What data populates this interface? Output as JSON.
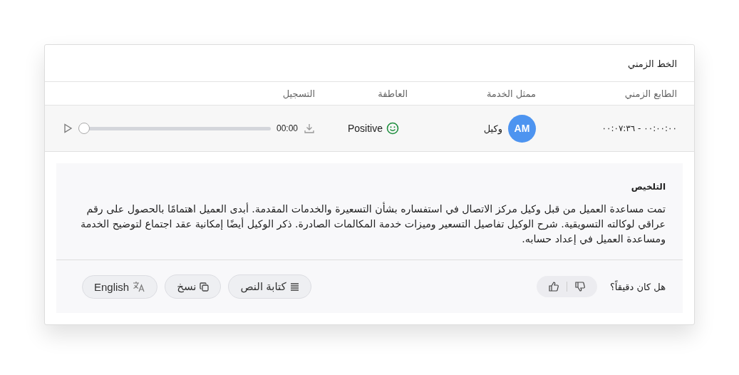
{
  "card": {
    "title": "الخط الزمني"
  },
  "table": {
    "columns": [
      "الطابع الزمني",
      "ممثل الخدمة",
      "العاطفة",
      "التسجيل"
    ],
    "rows": [
      {
        "timestamp": "٠٠:٠٠:٠٠ - ٠٠:٠٧:٣٦",
        "agent_initials": "AM",
        "agent_name": "وكيل",
        "sentiment": "Positive",
        "recording": {
          "time": "00:00",
          "level": 0
        }
      }
    ]
  },
  "summary": {
    "heading": "التلخيص",
    "text": "تمت مساعدة العميل من قبل وكيل مركز الاتصال في استفساره بشأن التسعيرة والخدمات المقدمة. أبدى العميل اهتمامًا بالحصول على رقم عراقي لوكالته التسويقية. شرح الوكيل تفاصيل التسعير وميزات خدمة المكالمات الصادرة. ذكر الوكيل أيضًا إمكانية عقد اجتماع لتوضيح الخدمة ومساعدة العميل في إعداد حسابه.",
    "feedback_question": "هل كان دقيقاً؟",
    "actions": [
      {
        "kind": "transcript",
        "label": "كتابة النص"
      },
      {
        "kind": "copy",
        "label": "نسخ"
      },
      {
        "kind": "translate",
        "label": "English"
      }
    ]
  }
}
